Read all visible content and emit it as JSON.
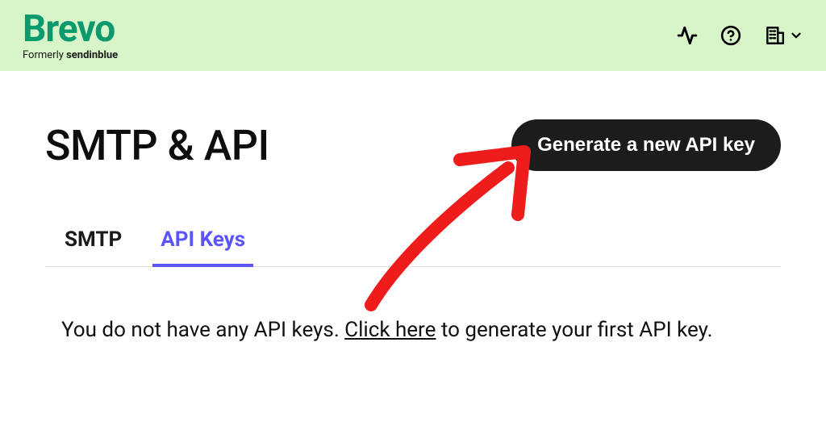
{
  "brand": {
    "name": "Brevo",
    "former_prefix": "Formerly ",
    "former_name": "sendinblue"
  },
  "page": {
    "title": "SMTP & API",
    "generate_button": "Generate a new API key"
  },
  "tabs": [
    {
      "label": "SMTP",
      "active": false
    },
    {
      "label": "API Keys",
      "active": true
    }
  ],
  "empty_state": {
    "pre": "You do not have any API keys. ",
    "link": "Click here",
    "post": " to generate your first API key."
  }
}
